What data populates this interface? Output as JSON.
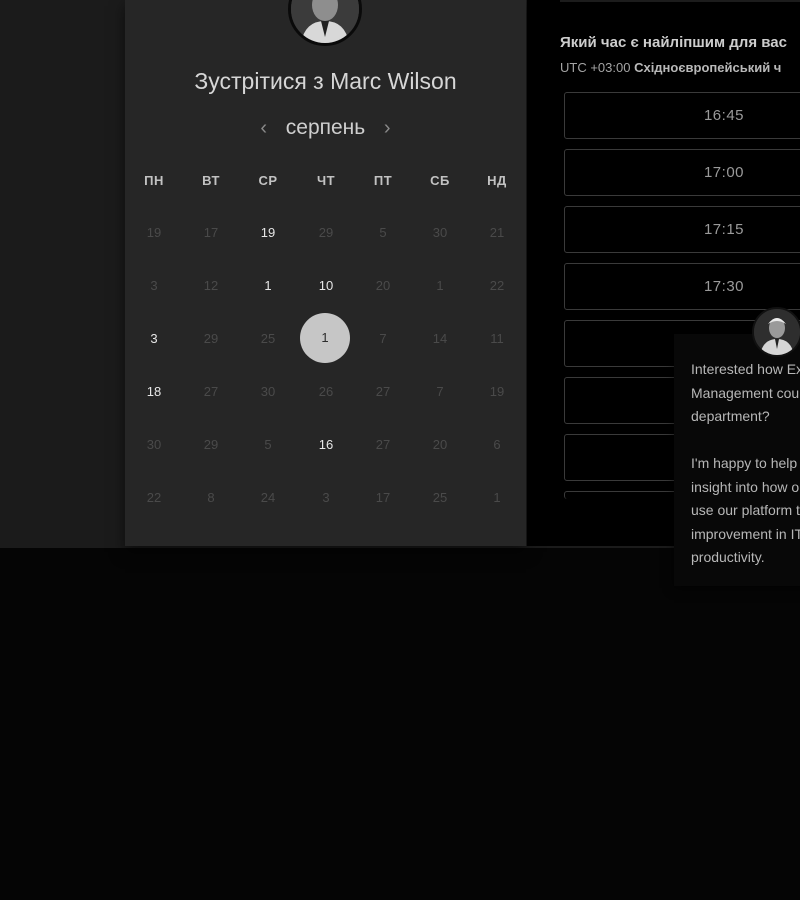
{
  "scheduler": {
    "title": "Зустрітися з Marc Wilson",
    "month": "серпень",
    "prev_icon": "‹",
    "next_icon": "›",
    "weekdays": [
      "ПН",
      "ВТ",
      "СР",
      "ЧТ",
      "ПТ",
      "СБ",
      "НД"
    ],
    "weeks": [
      [
        {
          "d": "19",
          "a": false
        },
        {
          "d": "17",
          "a": false
        },
        {
          "d": "19",
          "a": true
        },
        {
          "d": "29",
          "a": false
        },
        {
          "d": "5",
          "a": false
        },
        {
          "d": "30",
          "a": false
        },
        {
          "d": "21",
          "a": false
        }
      ],
      [
        {
          "d": "3",
          "a": false
        },
        {
          "d": "12",
          "a": false
        },
        {
          "d": "1",
          "a": true
        },
        {
          "d": "10",
          "a": true
        },
        {
          "d": "20",
          "a": false
        },
        {
          "d": "1",
          "a": false
        },
        {
          "d": "22",
          "a": false
        }
      ],
      [
        {
          "d": "3",
          "a": true
        },
        {
          "d": "29",
          "a": false
        },
        {
          "d": "25",
          "a": false
        },
        {
          "d": "1",
          "a": true,
          "selected": true
        },
        {
          "d": "7",
          "a": false
        },
        {
          "d": "14",
          "a": false
        },
        {
          "d": "11",
          "a": false
        }
      ],
      [
        {
          "d": "18",
          "a": true
        },
        {
          "d": "27",
          "a": false
        },
        {
          "d": "30",
          "a": false
        },
        {
          "d": "26",
          "a": false
        },
        {
          "d": "27",
          "a": false
        },
        {
          "d": "7",
          "a": false
        },
        {
          "d": "19",
          "a": false
        }
      ],
      [
        {
          "d": "30",
          "a": false
        },
        {
          "d": "29",
          "a": false
        },
        {
          "d": "5",
          "a": false
        },
        {
          "d": "16",
          "a": true
        },
        {
          "d": "27",
          "a": false
        },
        {
          "d": "20",
          "a": false
        },
        {
          "d": "6",
          "a": false
        }
      ],
      [
        {
          "d": "22",
          "a": false
        },
        {
          "d": "8",
          "a": false
        },
        {
          "d": "24",
          "a": false
        },
        {
          "d": "3",
          "a": false
        },
        {
          "d": "17",
          "a": false
        },
        {
          "d": "25",
          "a": false
        },
        {
          "d": "1",
          "a": false
        }
      ]
    ]
  },
  "times": {
    "heading": "Який час є найліпшим для вас",
    "timezone_offset": "UTC +03:00",
    "timezone_name": "Східноєвропейський ч",
    "slots": [
      "16:45",
      "17:00",
      "17:15",
      "17:30",
      "",
      "",
      "",
      ""
    ]
  },
  "chat": {
    "lines": [
      "Interested how Ex",
      "Management cou",
      "department?",
      "",
      "I'm happy to help",
      "insight into how o",
      "use our platform t",
      "improvement in IT",
      "productivity."
    ]
  },
  "colors": {
    "selected_day": "#c6c6c6",
    "card_bg": "#262626",
    "panel_bg": "#000000"
  }
}
